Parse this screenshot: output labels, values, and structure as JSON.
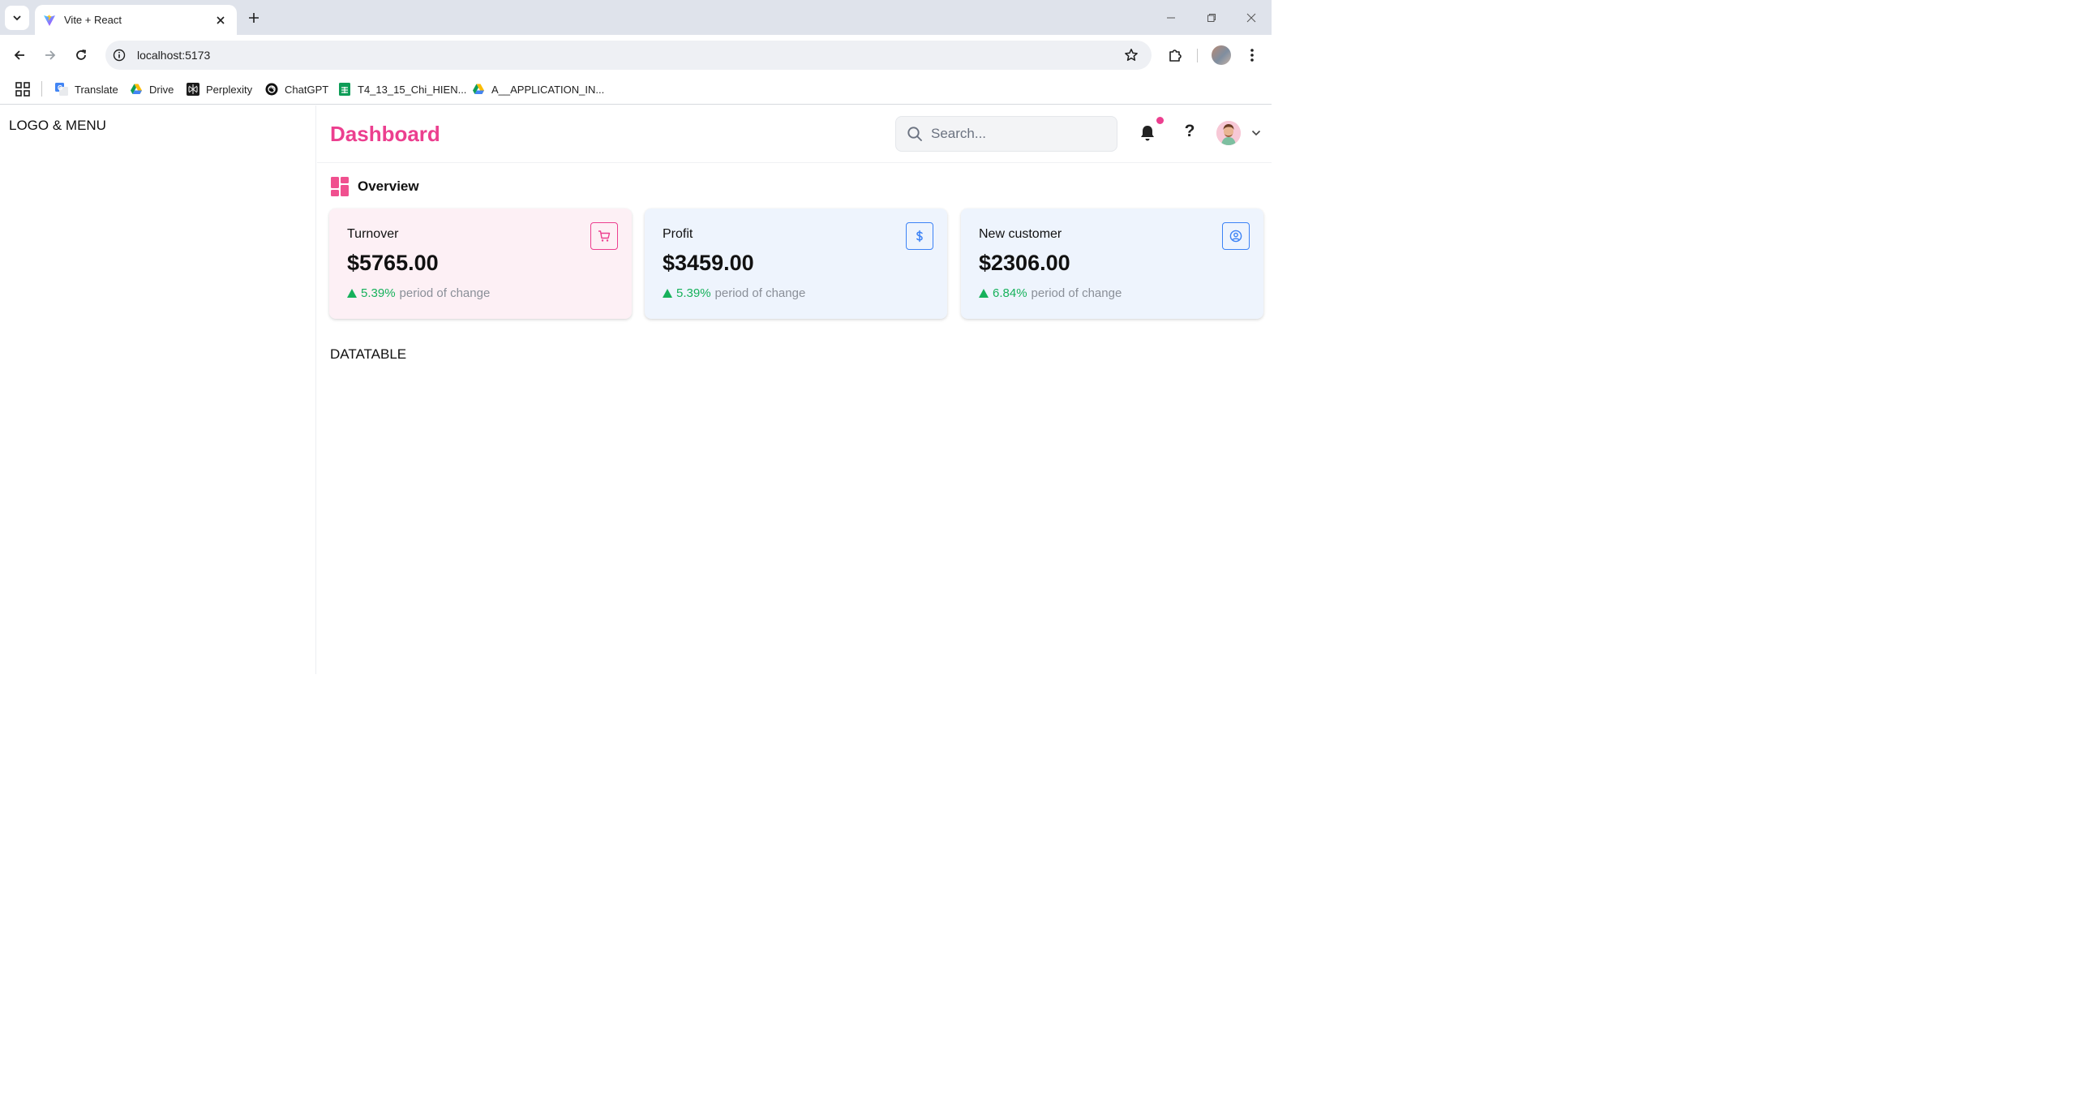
{
  "browser": {
    "tab_title": "Vite + React",
    "url": "localhost:5173",
    "bookmarks": [
      {
        "label": "Translate",
        "icon": "google-translate-icon"
      },
      {
        "label": "Drive",
        "icon": "google-drive-icon"
      },
      {
        "label": "Perplexity",
        "icon": "perplexity-icon"
      },
      {
        "label": "ChatGPT",
        "icon": "chatgpt-icon"
      },
      {
        "label": "T4_13_15_Chi_HIEN...",
        "icon": "google-sheets-icon"
      },
      {
        "label": "A__APPLICATION_IN...",
        "icon": "google-drive-icon"
      }
    ]
  },
  "sidebar": {
    "text": "LOGO & MENU"
  },
  "header": {
    "title": "Dashboard",
    "search_placeholder": "Search...",
    "help_label": "?",
    "accent_color": "#ec3f8f"
  },
  "overview": {
    "title": "Overview"
  },
  "cards": [
    {
      "label": "Turnover",
      "value": "$5765.00",
      "change": "5.39%",
      "period": "period of change",
      "icon": "cart-icon",
      "bg": "#fdf0f5",
      "border": "#ec3f8f"
    },
    {
      "label": "Profit",
      "value": "$3459.00",
      "change": "5.39%",
      "period": "period of change",
      "icon": "dollar-icon",
      "bg": "#eef4fd",
      "border": "#3b82f6"
    },
    {
      "label": "New customer",
      "value": "$2306.00",
      "change": "6.84%",
      "period": "period of change",
      "icon": "user-circle-icon",
      "bg": "#eef4fd",
      "border": "#3b82f6"
    }
  ],
  "datatable": {
    "label": "DATATABLE"
  }
}
